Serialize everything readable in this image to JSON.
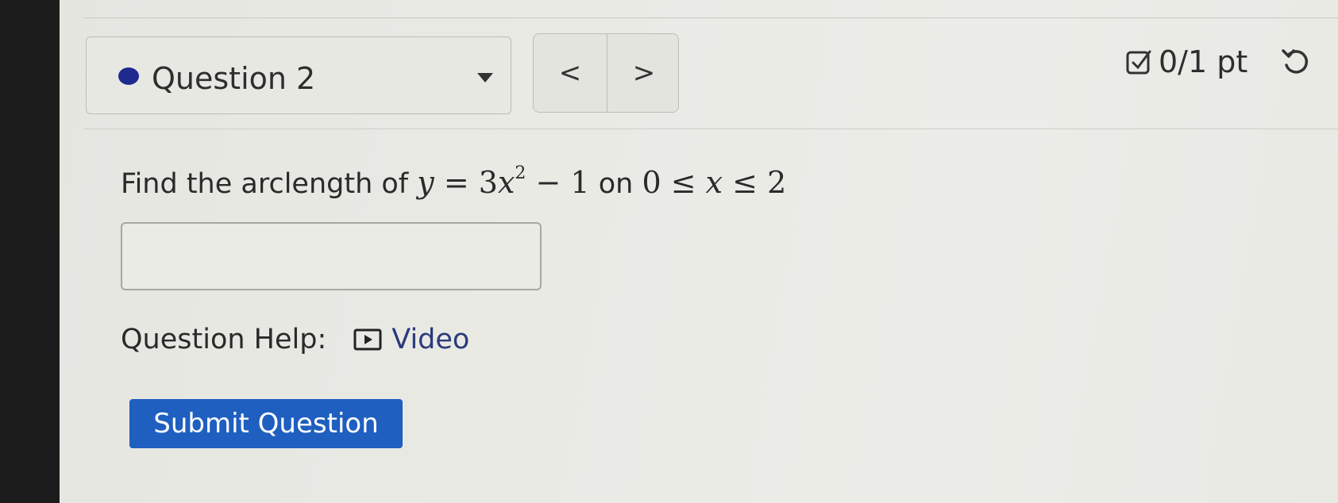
{
  "question_nav": {
    "label": "Question 2",
    "prev_label": "<",
    "next_label": ">"
  },
  "score": {
    "text": "0/1 pt"
  },
  "prompt": {
    "lead": "Find the arclength of",
    "func_y": "y",
    "eq": " = 3",
    "func_x": "x",
    "exp": "2",
    "tail": " − 1",
    "on": "on",
    "range_start": "0 ≤ ",
    "range_var": "x",
    "range_end": " ≤ 2"
  },
  "answer": {
    "value": "",
    "placeholder": ""
  },
  "help": {
    "label": "Question Help:",
    "video_label": "Video"
  },
  "submit": {
    "label": "Submit Question"
  },
  "colors": {
    "accent": "#1e5fc0",
    "status_dot": "#1f2a8e"
  },
  "icons": [
    "status-dot-icon",
    "caret-down-icon",
    "checkbox-icon",
    "retry-icon",
    "video-icon"
  ]
}
